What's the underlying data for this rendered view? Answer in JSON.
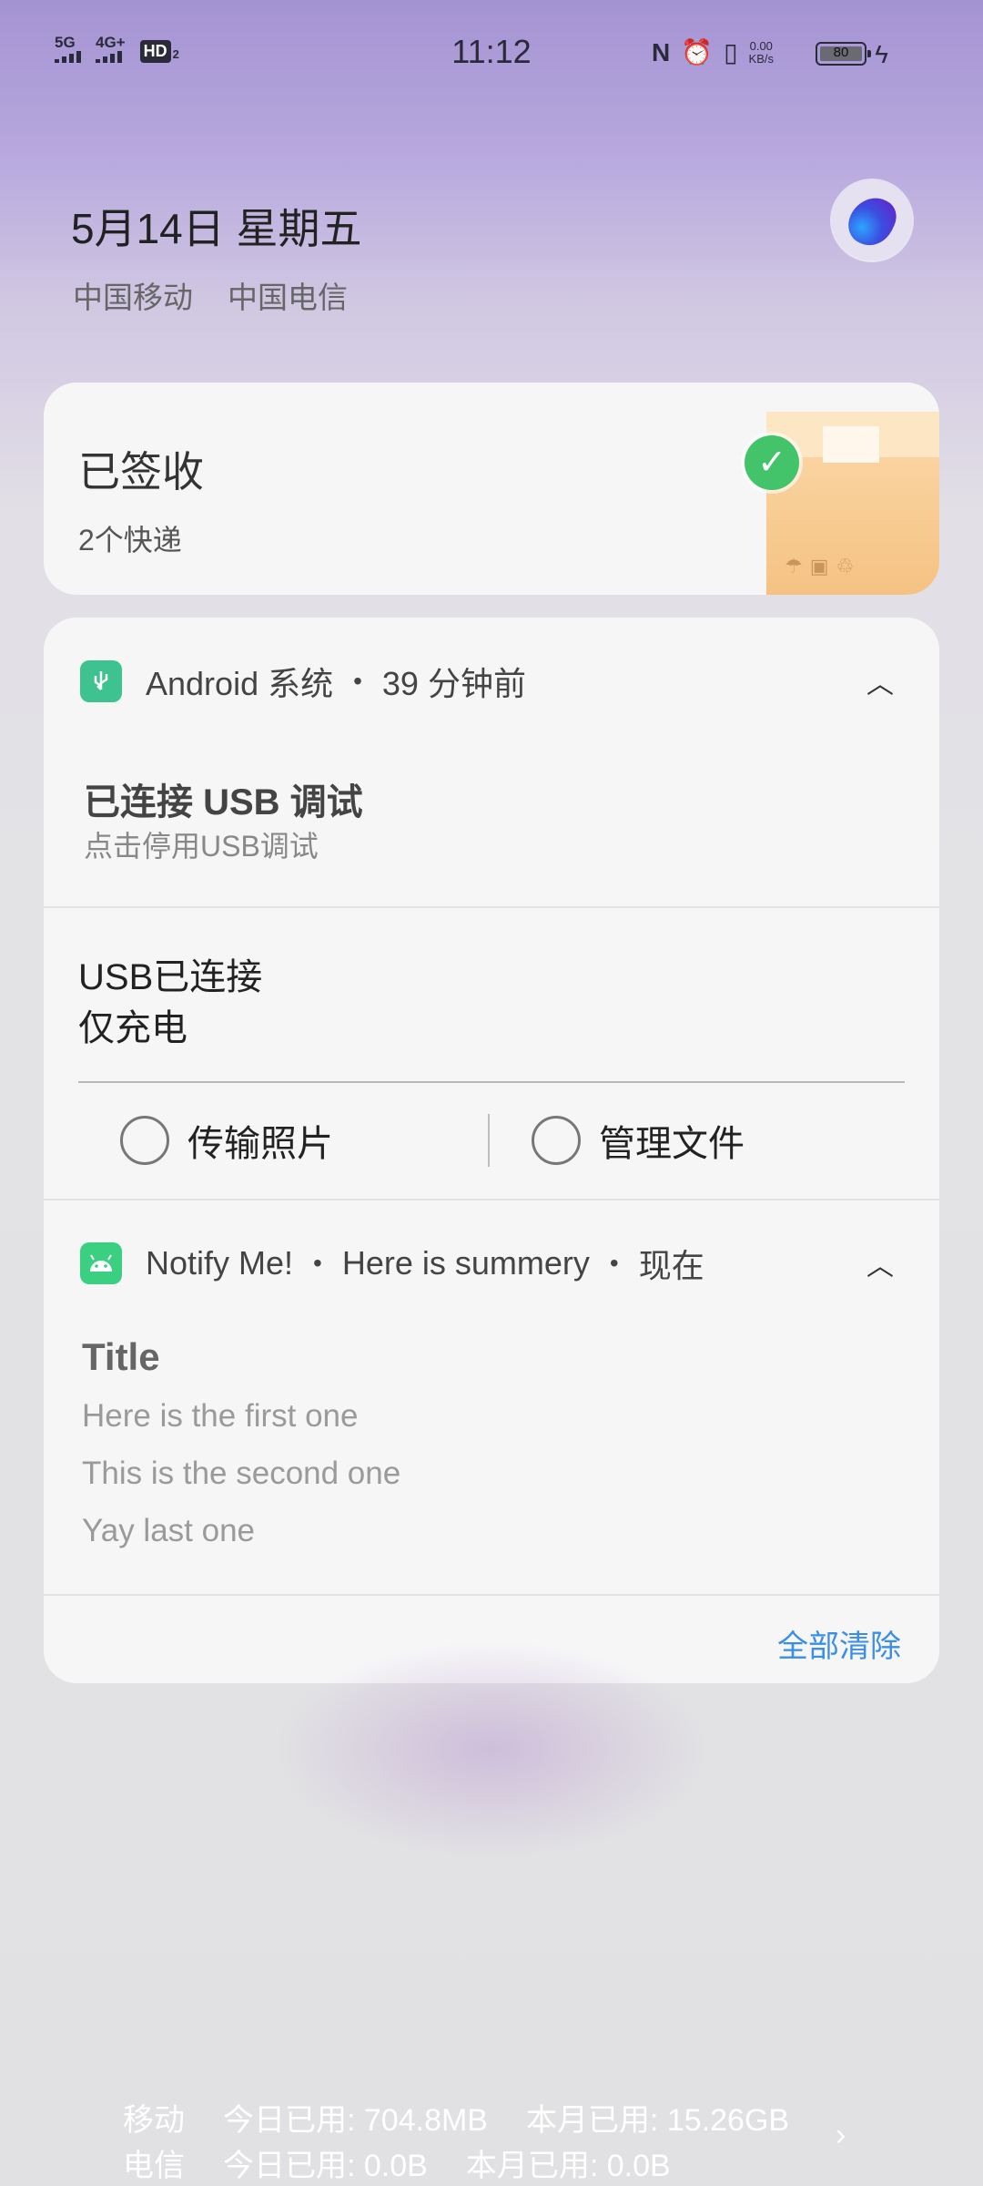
{
  "status_bar": {
    "sim1": "5G",
    "sim2": "4G+",
    "hd": "HD",
    "hd_sub": "2",
    "time": "11:12",
    "nfc_icon": "nfc-icon",
    "alarm_icon": "alarm-icon",
    "vibrate_icon": "vibrate-icon",
    "net_speed_value": "0.00",
    "net_speed_unit": "KB/s",
    "battery": "80",
    "charging_icon": "charging-bolt-icon"
  },
  "header": {
    "date": "5月14日 星期五",
    "carrier1": "中国移动",
    "carrier2": "中国电信"
  },
  "parcel_card": {
    "title": "已签收",
    "subtitle": "2个快递"
  },
  "notifications": [
    {
      "app": "Android 系统",
      "time": "39 分钟前",
      "title": "已连接 USB 调试",
      "text": "点击停用USB调试"
    },
    {
      "title": "USB已连接",
      "text": "仅充电",
      "options": [
        "传输照片",
        "管理文件"
      ]
    },
    {
      "app": "Notify Me!",
      "summary": "Here is summery",
      "time": "现在",
      "title": "Title",
      "lines": [
        "Here is the first one",
        "This is the second one",
        "Yay last one"
      ]
    }
  ],
  "clear_all": "全部清除",
  "data_usage": [
    {
      "carrier": "移动",
      "today": "今日已用: 704.8MB",
      "month": "本月已用: 15.26GB"
    },
    {
      "carrier": "电信",
      "today": "今日已用: 0.0B",
      "month": "本月已用: 0.0B"
    }
  ],
  "colors": {
    "accent": "#3a8ee6",
    "check_green": "#43c46a"
  }
}
